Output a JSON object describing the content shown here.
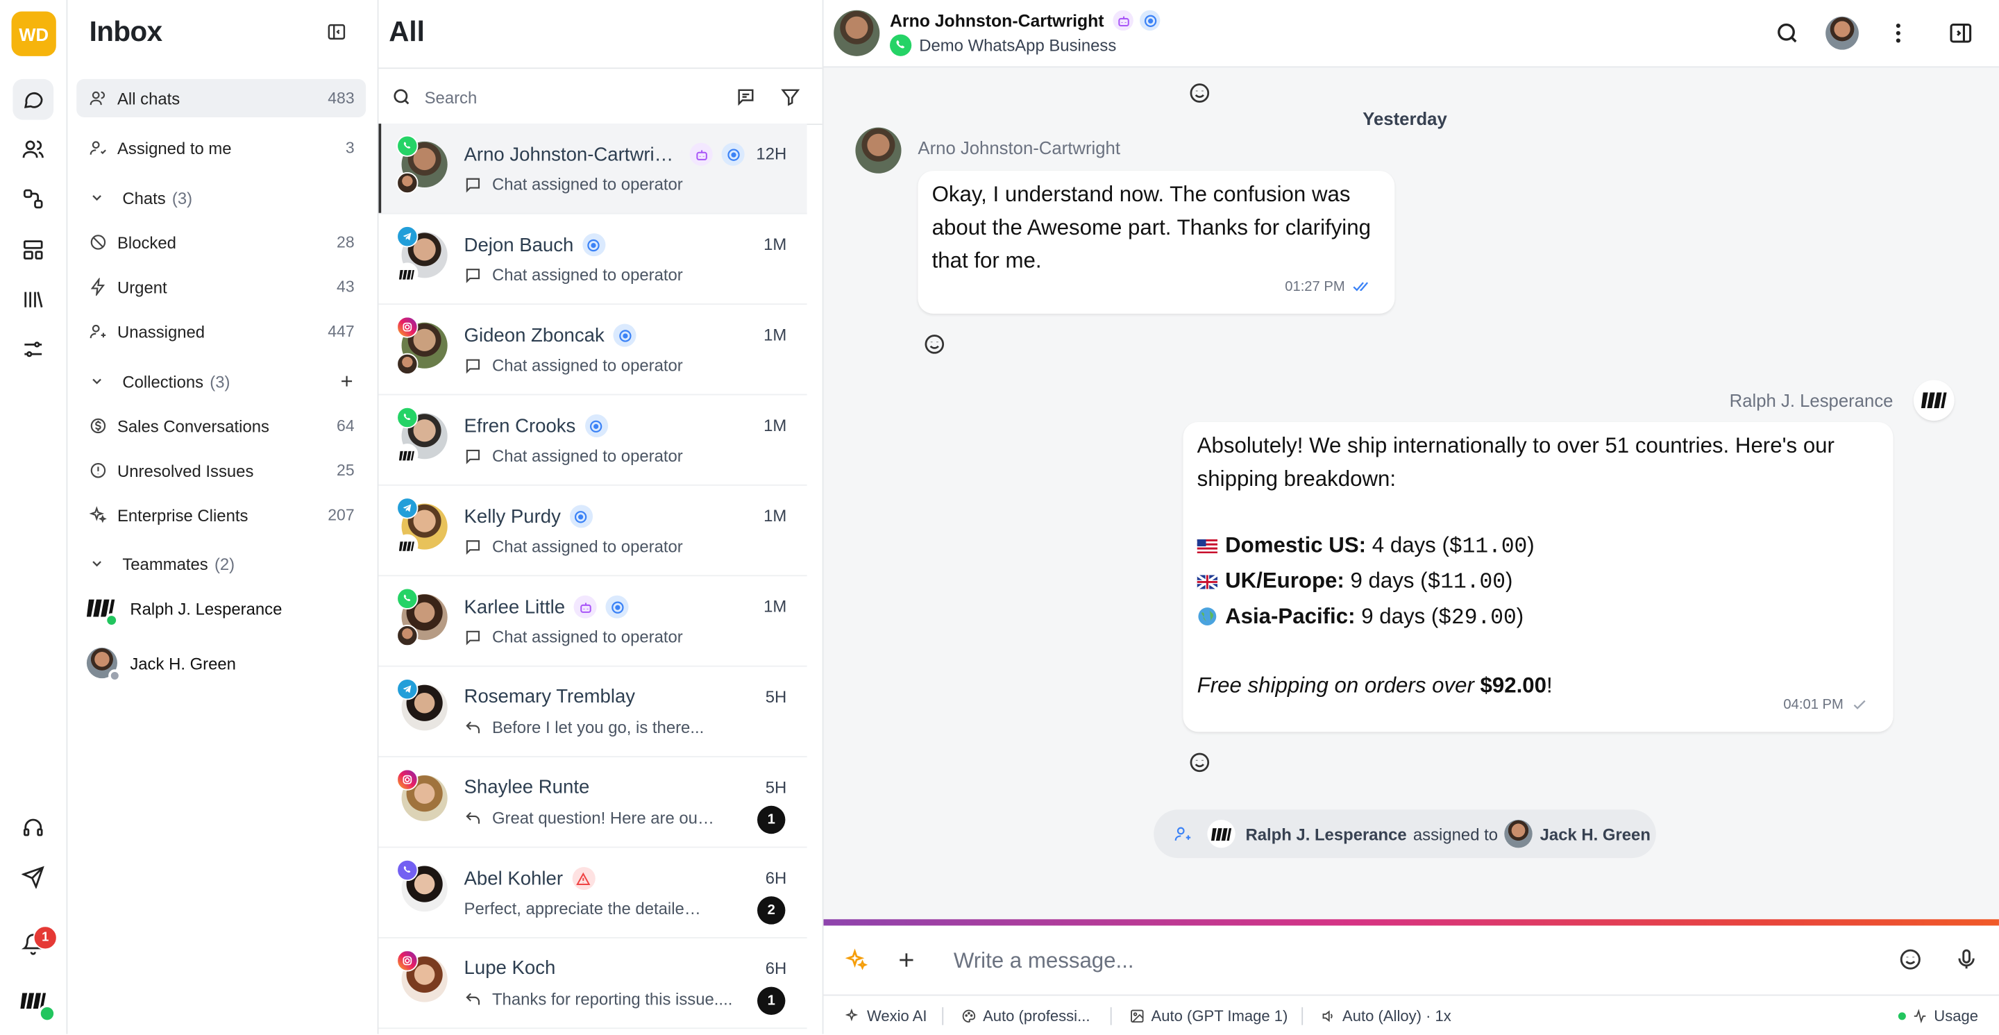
{
  "rail": {
    "logo": "WD",
    "notification_count": "1"
  },
  "sidebar": {
    "title": "Inbox",
    "items": [
      {
        "label": "All chats",
        "count": "483"
      },
      {
        "label": "Assigned to me",
        "count": "3"
      }
    ],
    "chats_group": {
      "label": "Chats",
      "count": "(3)"
    },
    "chat_items": [
      {
        "label": "Blocked",
        "count": "28"
      },
      {
        "label": "Urgent",
        "count": "43"
      },
      {
        "label": "Unassigned",
        "count": "447"
      }
    ],
    "collections_group": {
      "label": "Collections",
      "count": "(3)"
    },
    "collection_items": [
      {
        "label": "Sales Conversations",
        "count": "64"
      },
      {
        "label": "Unresolved Issues",
        "count": "25"
      },
      {
        "label": "Enterprise Clients",
        "count": "207"
      }
    ],
    "teammates_group": {
      "label": "Teammates",
      "count": "(2)"
    },
    "teammates": [
      {
        "name": "Ralph J. Lesperance"
      },
      {
        "name": "Jack H. Green"
      }
    ]
  },
  "list": {
    "title": "All",
    "search_placeholder": "Search",
    "conversations": [
      {
        "name": "Arno Johnston-Cartwright",
        "time": "12H",
        "preview": "Chat assigned to operator",
        "channel": "whatsapp"
      },
      {
        "name": "Dejon Bauch",
        "time": "1M",
        "preview": "Chat assigned to operator",
        "channel": "telegram"
      },
      {
        "name": "Gideon Zboncak",
        "time": "1M",
        "preview": "Chat assigned to operator",
        "channel": "instagram"
      },
      {
        "name": "Efren Crooks",
        "time": "1M",
        "preview": "Chat assigned to operator",
        "channel": "whatsapp"
      },
      {
        "name": "Kelly Purdy",
        "time": "1M",
        "preview": "Chat assigned to operator",
        "channel": "telegram"
      },
      {
        "name": "Karlee Little",
        "time": "1M",
        "preview": "Chat assigned to operator",
        "channel": "whatsapp"
      },
      {
        "name": "Rosemary Tremblay",
        "time": "5H",
        "preview": "Before I let you go, is there...",
        "channel": "telegram"
      },
      {
        "name": "Shaylee Runte",
        "time": "5H",
        "preview": "Great question! Here are our...",
        "unread": "1",
        "channel": "instagram"
      },
      {
        "name": "Abel Kohler",
        "time": "6H",
        "preview": "Perfect, appreciate the detailed...",
        "unread": "2",
        "channel": "viber"
      },
      {
        "name": "Lupe Koch",
        "time": "6H",
        "preview": "Thanks for reporting this issue....",
        "unread": "1",
        "channel": "instagram"
      }
    ]
  },
  "chat": {
    "contact_name": "Arno Johnston-Cartwright",
    "channel_label": "Demo WhatsApp Business",
    "day_label": "Yesterday",
    "msg1": {
      "sender": "Arno Johnston-Cartwright",
      "text": "Okay, I understand now. The confusion was about the Awesome part. Thanks for clarifying that for me.",
      "time": "01:27 PM"
    },
    "msg2": {
      "sender": "Ralph J. Lesperance",
      "intro": "Absolutely! We ship internationally to over 51 countries. Here's our shipping breakdown:",
      "rows": [
        {
          "flag": "🇺🇸",
          "label": "Domestic US:",
          "days": "4 days (",
          "price": "$11.00",
          "close": ")"
        },
        {
          "flag": "🇬🇧",
          "label": "UK/Europe:",
          "days": "9 days (",
          "price": "$11.00",
          "close": ")"
        },
        {
          "flag": "🌏",
          "label": "Asia-Pacific:",
          "days": "9 days (",
          "price": "$29.00",
          "close": ")"
        }
      ],
      "free_prefix": "Free shipping on orders over ",
      "free_amount": "$92.00",
      "free_suffix": "!",
      "time": "04:01 PM"
    },
    "system": {
      "from": "Ralph J. Lesperance",
      "action": "assigned to",
      "to": "Jack H. Green"
    },
    "composer_placeholder": "Write a message...",
    "toolbar": {
      "ai": "Wexio AI",
      "tone": "Auto (professi...",
      "image": "Auto (GPT Image 1)",
      "voice": "Auto (Alloy) · 1x",
      "usage": "Usage"
    }
  },
  "colors": {
    "logo": "#f6b40c",
    "whatsapp": "#25d366",
    "telegram": "#229ed9",
    "viber": "#7360f2",
    "badge": "#e53935",
    "bot_tag": "#f3e8ff",
    "op_tag": "#dbeafe"
  }
}
